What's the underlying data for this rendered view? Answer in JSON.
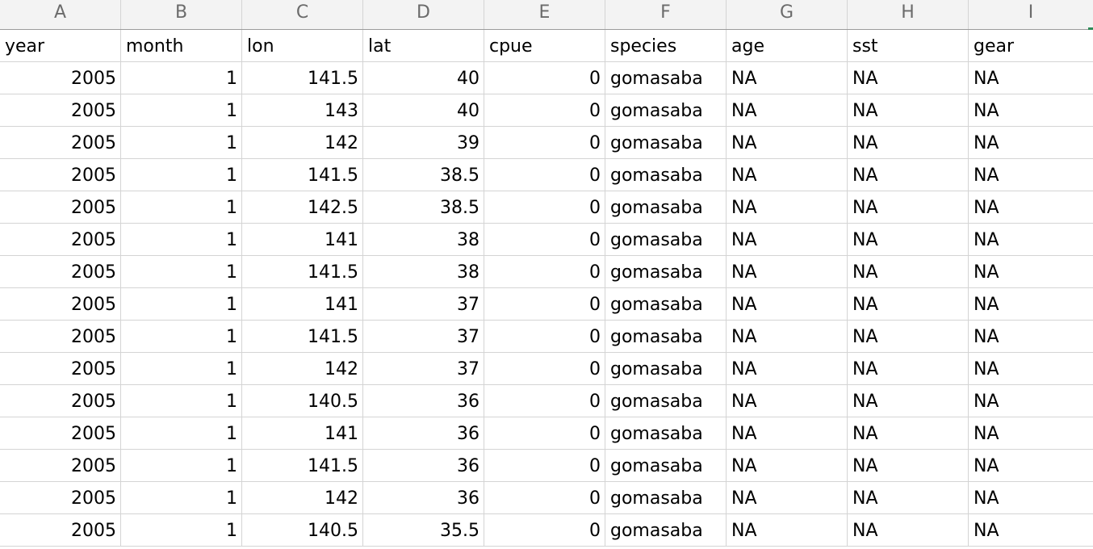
{
  "column_letters": [
    "A",
    "B",
    "C",
    "D",
    "E",
    "F",
    "G",
    "H",
    "I"
  ],
  "header_row": [
    "year",
    "month",
    "lon",
    "lat",
    "cpue",
    "species",
    "age",
    "sst",
    "gear"
  ],
  "rows": [
    [
      "2005",
      "1",
      "141.5",
      "40",
      "0",
      "gomasaba",
      "NA",
      "NA",
      "NA"
    ],
    [
      "2005",
      "1",
      "143",
      "40",
      "0",
      "gomasaba",
      "NA",
      "NA",
      "NA"
    ],
    [
      "2005",
      "1",
      "142",
      "39",
      "0",
      "gomasaba",
      "NA",
      "NA",
      "NA"
    ],
    [
      "2005",
      "1",
      "141.5",
      "38.5",
      "0",
      "gomasaba",
      "NA",
      "NA",
      "NA"
    ],
    [
      "2005",
      "1",
      "142.5",
      "38.5",
      "0",
      "gomasaba",
      "NA",
      "NA",
      "NA"
    ],
    [
      "2005",
      "1",
      "141",
      "38",
      "0",
      "gomasaba",
      "NA",
      "NA",
      "NA"
    ],
    [
      "2005",
      "1",
      "141.5",
      "38",
      "0",
      "gomasaba",
      "NA",
      "NA",
      "NA"
    ],
    [
      "2005",
      "1",
      "141",
      "37",
      "0",
      "gomasaba",
      "NA",
      "NA",
      "NA"
    ],
    [
      "2005",
      "1",
      "141.5",
      "37",
      "0",
      "gomasaba",
      "NA",
      "NA",
      "NA"
    ],
    [
      "2005",
      "1",
      "142",
      "37",
      "0",
      "gomasaba",
      "NA",
      "NA",
      "NA"
    ],
    [
      "2005",
      "1",
      "140.5",
      "36",
      "0",
      "gomasaba",
      "NA",
      "NA",
      "NA"
    ],
    [
      "2005",
      "1",
      "141",
      "36",
      "0",
      "gomasaba",
      "NA",
      "NA",
      "NA"
    ],
    [
      "2005",
      "1",
      "141.5",
      "36",
      "0",
      "gomasaba",
      "NA",
      "NA",
      "NA"
    ],
    [
      "2005",
      "1",
      "142",
      "36",
      "0",
      "gomasaba",
      "NA",
      "NA",
      "NA"
    ],
    [
      "2005",
      "1",
      "140.5",
      "35.5",
      "0",
      "gomasaba",
      "NA",
      "NA",
      "NA"
    ]
  ],
  "colors": {
    "header_background": "#f3f3f3",
    "header_text": "#6b6b6b",
    "gridline": "#d4d4d4",
    "selection_accent": "#2e8b57"
  }
}
